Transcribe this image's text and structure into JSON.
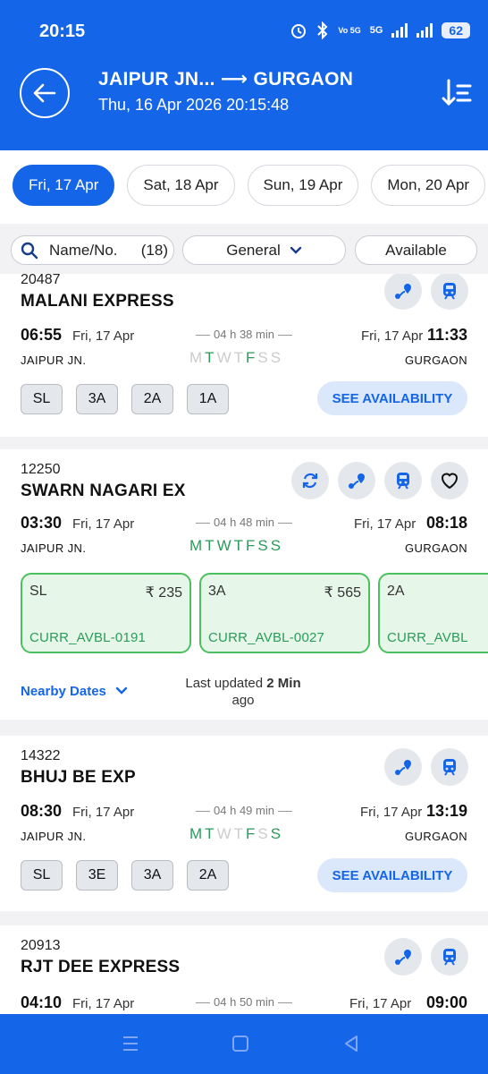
{
  "status": {
    "time": "20:15",
    "battery": "62",
    "net": "5G",
    "volte": "Vo 5G"
  },
  "header": {
    "title": "JAIPUR JN... ⟶ GURGAON",
    "subtitle": "Thu, 16 Apr 2026 20:15:48"
  },
  "dates": [
    "Fri, 17 Apr",
    "Sat, 18 Apr",
    "Sun, 19 Apr",
    "Mon, 20 Apr"
  ],
  "filters": {
    "name_label": "Name/No.",
    "count": "(18)",
    "quota": "General",
    "availability": "Available"
  },
  "trains": [
    {
      "number": "20487",
      "name": "MALANI EXPRESS",
      "dep_time": "06:55",
      "dep_date": "Fri, 17 Apr",
      "duration": "04 h 38 min",
      "arr_date": "Fri, 17 Apr",
      "arr_time": "11:33",
      "from": "JAIPUR JN.",
      "to": "GURGAON",
      "classes": [
        "SL",
        "3A",
        "2A",
        "1A"
      ],
      "see_availability": "SEE AVAILABILITY"
    },
    {
      "number": "12250",
      "name": "SWARN NAGARI EX",
      "dep_time": "03:30",
      "dep_date": "Fri, 17 Apr",
      "duration": "04 h 48 min",
      "arr_date": "Fri, 17 Apr",
      "arr_time": "08:18",
      "from": "JAIPUR JN.",
      "to": "GURGAON",
      "availability": [
        {
          "class": "SL",
          "fare": "₹ 235",
          "status": "CURR_AVBL-0191"
        },
        {
          "class": "3A",
          "fare": "₹ 565",
          "status": "CURR_AVBL-0027"
        },
        {
          "class": "2A",
          "fare": "",
          "status": "CURR_AVBL"
        }
      ],
      "nearby_dates": "Nearby Dates",
      "last_updated_prefix": "Last updated ",
      "last_updated_value": "2 Min",
      "last_updated_suffix": "ago"
    },
    {
      "number": "14322",
      "name": "BHUJ BE EXP",
      "dep_time": "08:30",
      "dep_date": "Fri, 17 Apr",
      "duration": "04 h 49 min",
      "arr_date": "Fri, 17 Apr",
      "arr_time": "13:19",
      "from": "JAIPUR JN.",
      "to": "GURGAON",
      "classes": [
        "SL",
        "3E",
        "3A",
        "2A"
      ],
      "see_availability": "SEE AVAILABILITY"
    },
    {
      "number": "20913",
      "name": "RJT DEE EXPRESS",
      "dep_time": "04:10",
      "dep_date": "Fri, 17 Apr",
      "duration": "04 h 50 min",
      "arr_date": "Fri, 17 Apr",
      "arr_time": "09:00"
    }
  ],
  "days_letters": [
    "M",
    "T",
    "W",
    "T",
    "F",
    "S",
    "S"
  ],
  "colors": {
    "primary": "#1565e8",
    "green": "#2c9a5a",
    "green_border": "#4cc05f"
  },
  "icons": [
    "back-arrow-icon",
    "sort-icon",
    "search-icon",
    "route-icon",
    "train-icon",
    "refresh-icon",
    "heart-icon",
    "chevron-down-icon"
  ]
}
